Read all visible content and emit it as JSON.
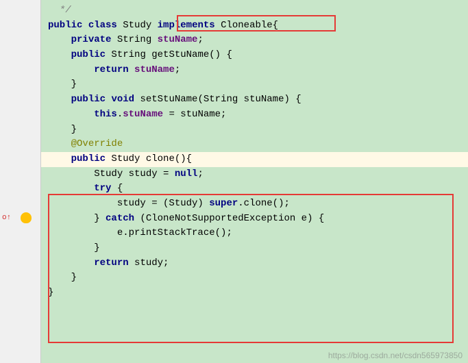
{
  "code": {
    "line1": "  */",
    "line2_part1": "public",
    "line2_part2": " ",
    "line2_part3": "class",
    "line2_part4": " Study ",
    "line2_part5": "implements",
    "line2_part6": " Cloneable{",
    "line3_part1": "    ",
    "line3_part2": "private",
    "line3_part3": " String ",
    "line3_part4": "stuName",
    "line3_part5": ";",
    "line4": "",
    "line5_part1": "    ",
    "line5_part2": "public",
    "line5_part3": " String getStuName() {",
    "line6_part1": "        ",
    "line6_part2": "return",
    "line6_part3": " ",
    "line6_part4": "stuName",
    "line6_part5": ";",
    "line7": "    }",
    "line8": "",
    "line9_part1": "    ",
    "line9_part2": "public",
    "line9_part3": " ",
    "line9_part4": "void",
    "line9_part5": " setStuName(String stuName) {",
    "line10_part1": "        ",
    "line10_part2": "this",
    "line10_part3": ".",
    "line10_part4": "stuName",
    "line10_part5": " = stuName;",
    "line11": "    }",
    "line12_part1": "    ",
    "line12_part2": "@Override",
    "line13_part1": "    ",
    "line13_part2": "public",
    "line13_part3": " Study clone(){",
    "line14_part1": "        Study study = ",
    "line14_part2": "null",
    "line14_part3": ";",
    "line15_part1": "        ",
    "line15_part2": "try",
    "line15_part3": " {",
    "line16_part1": "            study = (Study) ",
    "line16_part2": "super",
    "line16_part3": ".clone();",
    "line17_part1": "        } ",
    "line17_part2": "catch",
    "line17_part3": " (CloneNotSupportedException e) {",
    "line18": "            e.printStackTrace();",
    "line19": "        }",
    "line20_part1": "        ",
    "line20_part2": "return",
    "line20_part3": " study;",
    "line21": "    }",
    "line22": "}"
  },
  "gutter": {
    "override_marker": "o↑"
  },
  "watermark": "https://blog.csdn.net/csdn565973850"
}
